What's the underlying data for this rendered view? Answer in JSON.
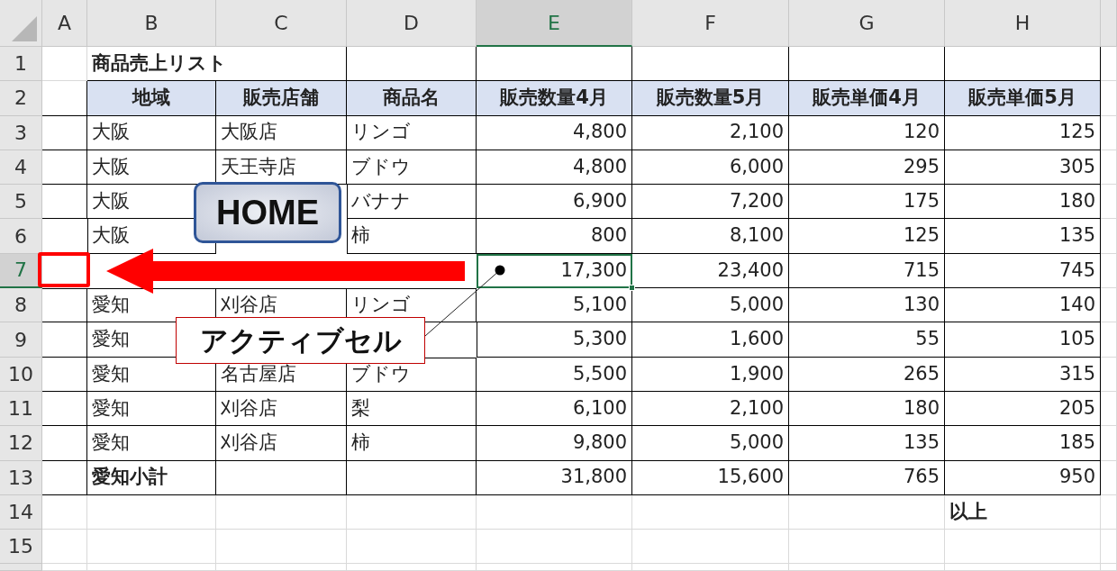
{
  "columns": [
    {
      "label": "A",
      "selected": false
    },
    {
      "label": "B",
      "selected": false
    },
    {
      "label": "C",
      "selected": false
    },
    {
      "label": "D",
      "selected": false
    },
    {
      "label": "E",
      "selected": true
    },
    {
      "label": "F",
      "selected": false
    },
    {
      "label": "G",
      "selected": false
    },
    {
      "label": "H",
      "selected": false
    }
  ],
  "rows": [
    {
      "number": "1",
      "selected": false,
      "cells": [
        null,
        {
          "kind": "title",
          "text": "商品売上リスト"
        },
        null,
        null,
        null,
        null,
        null,
        null
      ]
    },
    {
      "number": "2",
      "selected": false,
      "cells": [
        null,
        {
          "kind": "header",
          "text": "地域"
        },
        {
          "kind": "header",
          "text": "販売店舗"
        },
        {
          "kind": "header",
          "text": "商品名"
        },
        {
          "kind": "header",
          "text": "販売数量4月"
        },
        {
          "kind": "header",
          "text": "販売数量5月"
        },
        {
          "kind": "header",
          "text": "販売単価4月"
        },
        {
          "kind": "header",
          "text": "販売単価5月"
        }
      ]
    },
    {
      "number": "3",
      "selected": false,
      "cells": [
        null,
        {
          "kind": "text",
          "text": "大阪"
        },
        {
          "kind": "text",
          "text": "大阪店"
        },
        {
          "kind": "text",
          "text": "リンゴ"
        },
        {
          "kind": "number",
          "text": "4,800"
        },
        {
          "kind": "number",
          "text": "2,100"
        },
        {
          "kind": "number",
          "text": "120"
        },
        {
          "kind": "number",
          "text": "125"
        }
      ]
    },
    {
      "number": "4",
      "selected": false,
      "cells": [
        null,
        {
          "kind": "text",
          "text": "大阪"
        },
        {
          "kind": "text",
          "text": "天王寺店"
        },
        {
          "kind": "text",
          "text": "ブドウ"
        },
        {
          "kind": "number",
          "text": "4,800"
        },
        {
          "kind": "number",
          "text": "6,000"
        },
        {
          "kind": "number",
          "text": "295"
        },
        {
          "kind": "number",
          "text": "305"
        }
      ]
    },
    {
      "number": "5",
      "selected": false,
      "cells": [
        null,
        {
          "kind": "text",
          "text": "大阪"
        },
        null,
        {
          "kind": "text",
          "text": "バナナ"
        },
        {
          "kind": "number",
          "text": "6,900"
        },
        {
          "kind": "number",
          "text": "7,200"
        },
        {
          "kind": "number",
          "text": "175"
        },
        {
          "kind": "number",
          "text": "180"
        }
      ]
    },
    {
      "number": "6",
      "selected": false,
      "cells": [
        null,
        {
          "kind": "text",
          "text": "大阪"
        },
        null,
        {
          "kind": "text",
          "text": "柿"
        },
        {
          "kind": "number",
          "text": "800"
        },
        {
          "kind": "number",
          "text": "8,100"
        },
        {
          "kind": "number",
          "text": "125"
        },
        {
          "kind": "number",
          "text": "135"
        }
      ]
    },
    {
      "number": "7",
      "selected": true,
      "cells": [
        null,
        null,
        null,
        null,
        {
          "kind": "number",
          "text": "17,300"
        },
        {
          "kind": "number",
          "text": "23,400"
        },
        {
          "kind": "number",
          "text": "715"
        },
        {
          "kind": "number",
          "text": "745"
        }
      ]
    },
    {
      "number": "8",
      "selected": false,
      "cells": [
        null,
        {
          "kind": "text",
          "text": "愛知"
        },
        {
          "kind": "text",
          "text": "刈谷店"
        },
        {
          "kind": "text",
          "text": "リンゴ"
        },
        {
          "kind": "number",
          "text": "5,100"
        },
        {
          "kind": "number",
          "text": "5,000"
        },
        {
          "kind": "number",
          "text": "130"
        },
        {
          "kind": "number",
          "text": "140"
        }
      ]
    },
    {
      "number": "9",
      "selected": false,
      "cells": [
        null,
        {
          "kind": "text",
          "text": "愛知"
        },
        null,
        null,
        {
          "kind": "number",
          "text": "5,300"
        },
        {
          "kind": "number",
          "text": "1,600"
        },
        {
          "kind": "number",
          "text": "55"
        },
        {
          "kind": "number",
          "text": "105"
        }
      ]
    },
    {
      "number": "10",
      "selected": false,
      "cells": [
        null,
        {
          "kind": "text",
          "text": "愛知"
        },
        {
          "kind": "text",
          "text": "名古屋店"
        },
        {
          "kind": "text",
          "text": "ブドウ"
        },
        {
          "kind": "number",
          "text": "5,500"
        },
        {
          "kind": "number",
          "text": "1,900"
        },
        {
          "kind": "number",
          "text": "265"
        },
        {
          "kind": "number",
          "text": "315"
        }
      ]
    },
    {
      "number": "11",
      "selected": false,
      "cells": [
        null,
        {
          "kind": "text",
          "text": "愛知"
        },
        {
          "kind": "text",
          "text": "刈谷店"
        },
        {
          "kind": "text",
          "text": "梨"
        },
        {
          "kind": "number",
          "text": "6,100"
        },
        {
          "kind": "number",
          "text": "2,100"
        },
        {
          "kind": "number",
          "text": "180"
        },
        {
          "kind": "number",
          "text": "205"
        }
      ]
    },
    {
      "number": "12",
      "selected": false,
      "cells": [
        null,
        {
          "kind": "text",
          "text": "愛知"
        },
        {
          "kind": "text",
          "text": "刈谷店"
        },
        {
          "kind": "text",
          "text": "柿"
        },
        {
          "kind": "number",
          "text": "9,800"
        },
        {
          "kind": "number",
          "text": "5,000"
        },
        {
          "kind": "number",
          "text": "135"
        },
        {
          "kind": "number",
          "text": "185"
        }
      ]
    },
    {
      "number": "13",
      "selected": false,
      "cells": [
        null,
        {
          "kind": "total",
          "text": "愛知小計"
        },
        {
          "kind": "empty"
        },
        {
          "kind": "empty"
        },
        {
          "kind": "number",
          "text": "31,800"
        },
        {
          "kind": "number",
          "text": "15,600"
        },
        {
          "kind": "number",
          "text": "765"
        },
        {
          "kind": "number",
          "text": "950"
        }
      ]
    },
    {
      "number": "14",
      "selected": false,
      "cells": [
        null,
        null,
        null,
        null,
        null,
        null,
        null,
        {
          "kind": "title",
          "text": "以上"
        }
      ]
    },
    {
      "number": "15",
      "selected": false,
      "cells": [
        null,
        null,
        null,
        null,
        null,
        null,
        null,
        null
      ]
    }
  ],
  "annotations": [
    {
      "kind": "target_box"
    },
    {
      "kind": "arrow"
    },
    {
      "kind": "badge",
      "text": "HOME"
    },
    {
      "kind": "callout",
      "text": "アクティブセル"
    }
  ]
}
